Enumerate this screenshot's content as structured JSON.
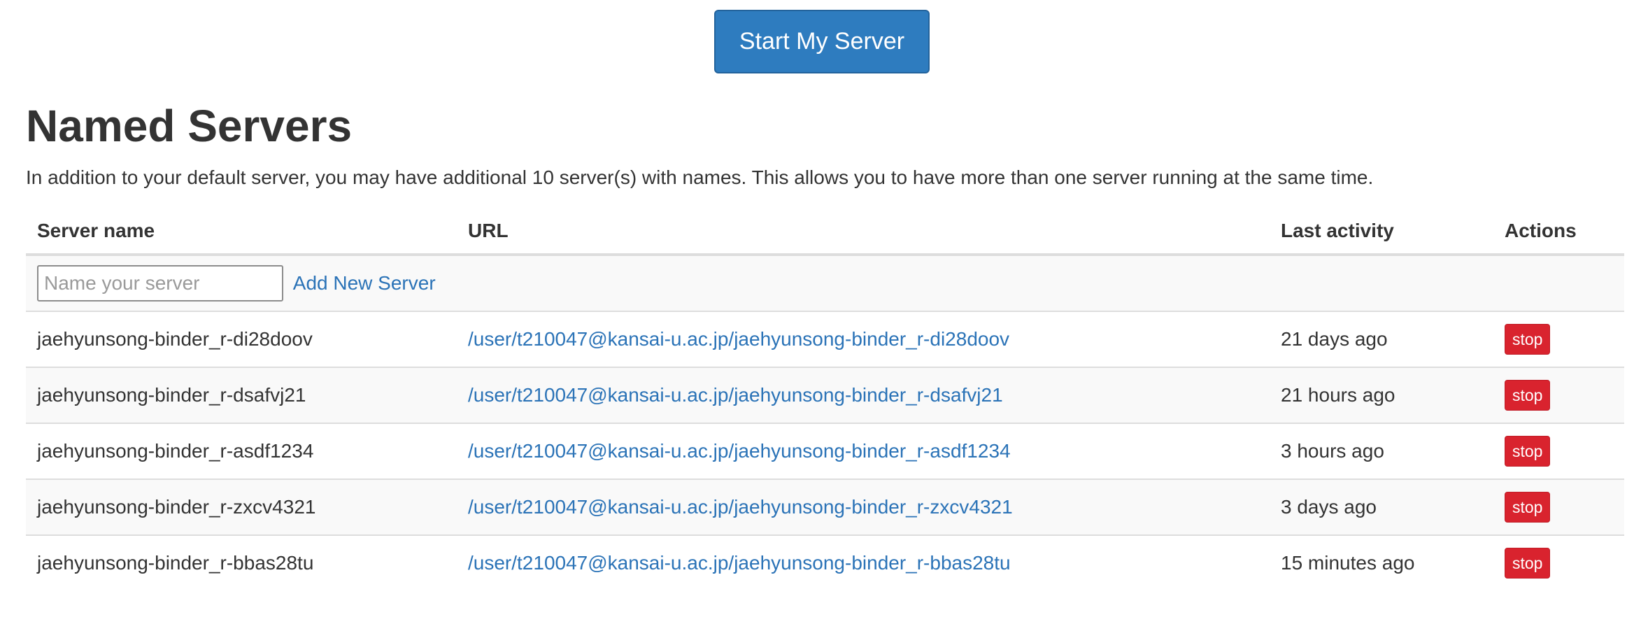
{
  "start_button": {
    "label": "Start My Server"
  },
  "named_servers": {
    "title": "Named Servers",
    "description": "In addition to your default server, you may have additional 10 server(s) with names. This allows you to have more than one server running at the same time."
  },
  "table": {
    "headers": {
      "server_name": "Server name",
      "url": "URL",
      "last_activity": "Last activity",
      "actions": "Actions"
    },
    "new_server": {
      "placeholder": "Name your server",
      "add_label": "Add New Server"
    },
    "rows": [
      {
        "name": "jaehyunsong-binder_r-di28doov",
        "url": "/user/t210047@kansai-u.ac.jp/jaehyunsong-binder_r-di28doov",
        "last_activity": "21 days ago",
        "action": "stop"
      },
      {
        "name": "jaehyunsong-binder_r-dsafvj21",
        "url": "/user/t210047@kansai-u.ac.jp/jaehyunsong-binder_r-dsafvj21",
        "last_activity": "21 hours ago",
        "action": "stop"
      },
      {
        "name": "jaehyunsong-binder_r-asdf1234",
        "url": "/user/t210047@kansai-u.ac.jp/jaehyunsong-binder_r-asdf1234",
        "last_activity": "3 hours ago",
        "action": "stop"
      },
      {
        "name": "jaehyunsong-binder_r-zxcv4321",
        "url": "/user/t210047@kansai-u.ac.jp/jaehyunsong-binder_r-zxcv4321",
        "last_activity": "3 days ago",
        "action": "stop"
      },
      {
        "name": "jaehyunsong-binder_r-bbas28tu",
        "url": "/user/t210047@kansai-u.ac.jp/jaehyunsong-binder_r-bbas28tu",
        "last_activity": "15 minutes ago",
        "action": "stop"
      }
    ]
  },
  "colors": {
    "primary_button": "#2e7cbf",
    "link": "#2b73b7",
    "danger_button": "#d9232e",
    "stripe": "#f9f9f9"
  }
}
